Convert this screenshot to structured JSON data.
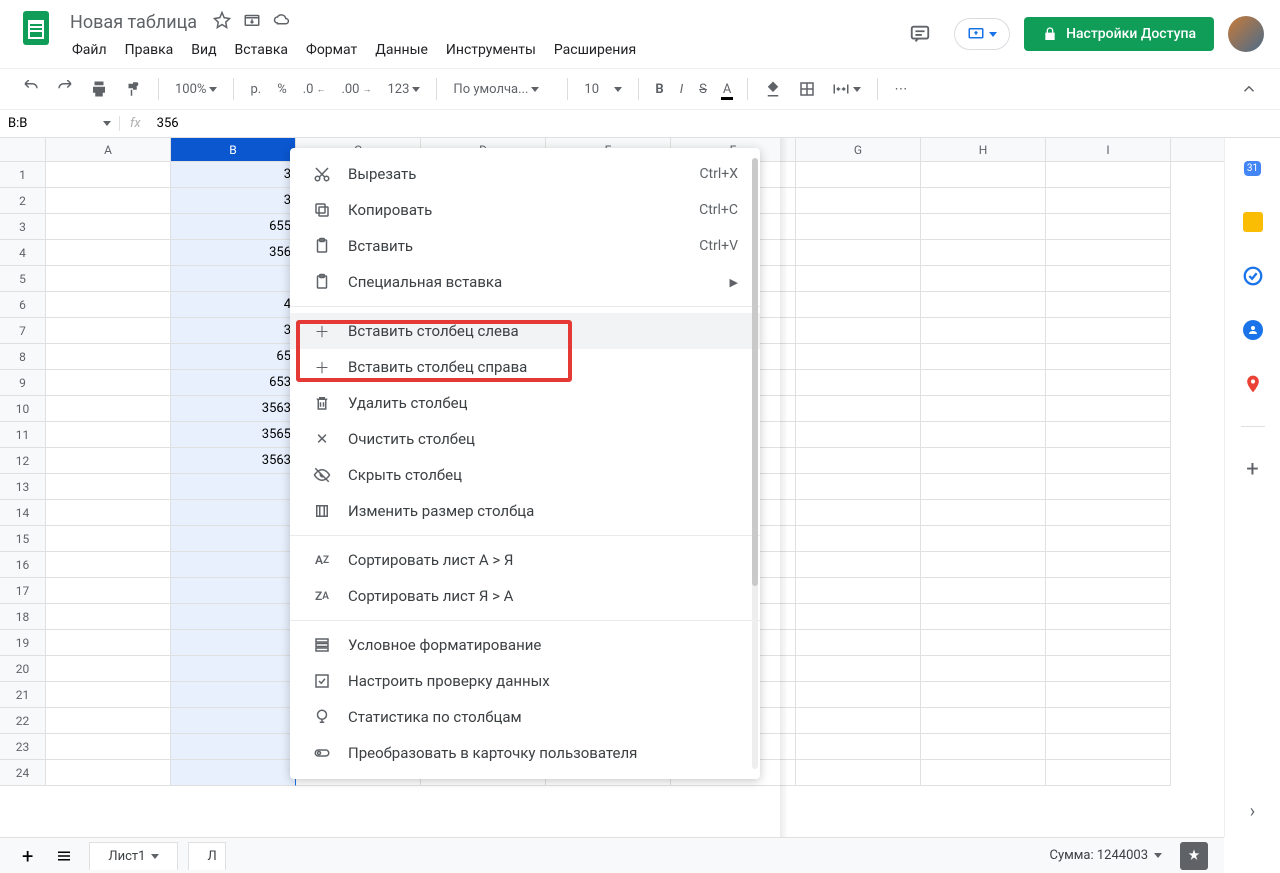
{
  "doc": {
    "title": "Новая таблица"
  },
  "menus": [
    "Файл",
    "Правка",
    "Вид",
    "Вставка",
    "Формат",
    "Данные",
    "Инструменты",
    "Расширения"
  ],
  "share_btn": "Настройки Доступа",
  "toolbar": {
    "zoom": "100%",
    "currency": "р.",
    "percent": "%",
    "dec_dec": ".0",
    "dec_inc": ".00",
    "num_fmt": "123",
    "font": "По умолча...",
    "size": "10",
    "more": "⋯"
  },
  "namebox": "B:B",
  "formula": "356",
  "columns": [
    "A",
    "B",
    "C",
    "D",
    "E",
    "F",
    "G",
    "H",
    "I"
  ],
  "selected_col_index": 1,
  "rows": 24,
  "cellsB": [
    "3",
    "3",
    "655",
    "356",
    "",
    "4",
    "3",
    "65",
    "653",
    "3563",
    "3565",
    "3563",
    "",
    "",
    "",
    "",
    "",
    "",
    "",
    "",
    "",
    "",
    "",
    ""
  ],
  "context_menu": {
    "cut": {
      "label": "Вырезать",
      "shortcut": "Ctrl+X"
    },
    "copy": {
      "label": "Копировать",
      "shortcut": "Ctrl+C"
    },
    "paste": {
      "label": "Вставить",
      "shortcut": "Ctrl+V"
    },
    "paste_special": {
      "label": "Специальная вставка"
    },
    "insert_left": {
      "label": "Вставить столбец слева"
    },
    "insert_right": {
      "label": "Вставить столбец справа"
    },
    "delete_col": {
      "label": "Удалить столбец"
    },
    "clear_col": {
      "label": "Очистить столбец"
    },
    "hide_col": {
      "label": "Скрыть столбец"
    },
    "resize_col": {
      "label": "Изменить размер столбца"
    },
    "sort_az": {
      "label": "Сортировать лист А > Я"
    },
    "sort_za": {
      "label": "Сортировать лист Я > А"
    },
    "cond_fmt": {
      "label": "Условное форматирование"
    },
    "data_valid": {
      "label": "Настроить проверку данных"
    },
    "col_stats": {
      "label": "Статистика по столбцам"
    },
    "people_chip": {
      "label": "Преобразовать в карточку пользователя"
    }
  },
  "sheets": {
    "tab1": "Лист1",
    "tab2_partial": "Л"
  },
  "status": "Сумма: 1244003",
  "sidepanel": {
    "calendar_day": "31"
  }
}
